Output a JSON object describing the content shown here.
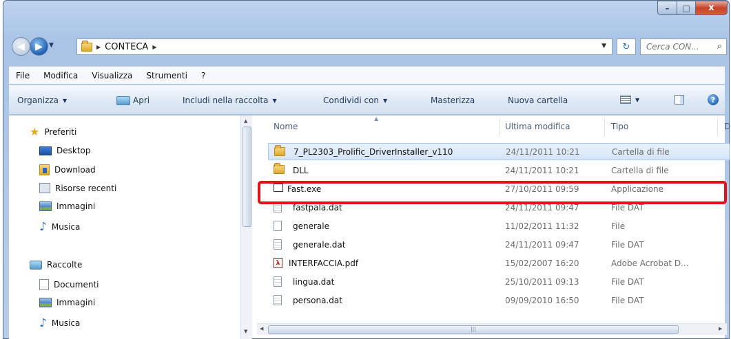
{
  "window": {
    "caption_buttons": {
      "minimize": "–",
      "maximize": "□",
      "close": "x"
    }
  },
  "address_bar": {
    "crumbs": [
      "CONTECA"
    ],
    "search_placeholder": "Cerca CON..."
  },
  "menu": [
    "File",
    "Modifica",
    "Visualizza",
    "Strumenti",
    "?"
  ],
  "commands": {
    "organize": "Organizza",
    "open": "Apri",
    "include": "Includi nella raccolta",
    "share": "Condividi con",
    "burn": "Masterizza",
    "new_folder": "Nuova cartella"
  },
  "navigation": {
    "favorites_header": "Preferiti",
    "favorites": [
      "Desktop",
      "Download",
      "Risorse recenti",
      "Immagini",
      "Musica"
    ],
    "libraries_header": "Raccolte",
    "libraries": [
      "Documenti",
      "Immagini",
      "Musica"
    ]
  },
  "file_list": {
    "columns": [
      "Nome",
      "Ultima modifica",
      "Tipo",
      "D"
    ],
    "rows": [
      {
        "name": "7_PL2303_Prolific_DriverInstaller_v110",
        "modified": "24/11/2011 10:21",
        "type": "Cartella di file",
        "icon": "folder-icon"
      },
      {
        "name": "DLL",
        "modified": "24/11/2011 10:21",
        "type": "Cartella di file",
        "icon": "folder-icon"
      },
      {
        "name": "Fast.exe",
        "modified": "27/10/2011 09:59",
        "type": "Applicazione",
        "icon": "exe-icon"
      },
      {
        "name": "fastpala.dat",
        "modified": "24/11/2011 09:47",
        "type": "File DAT",
        "icon": "dat-file-icon"
      },
      {
        "name": "generale",
        "modified": "11/02/2011 11:32",
        "type": "File",
        "icon": "file-icon"
      },
      {
        "name": "generale.dat",
        "modified": "24/11/2011 09:47",
        "type": "File DAT",
        "icon": "dat-file-icon"
      },
      {
        "name": "INTERFACCIA.pdf",
        "modified": "15/02/2007 16:20",
        "type": "Adobe Acrobat D...",
        "icon": "pdf-icon"
      },
      {
        "name": "lingua.dat",
        "modified": "25/10/2011 09:13",
        "type": "File DAT",
        "icon": "dat-file-icon"
      },
      {
        "name": "persona.dat",
        "modified": "09/09/2010 16:50",
        "type": "File DAT",
        "icon": "dat-file-icon"
      }
    ]
  },
  "colors": {
    "highlight": "#e3101a",
    "selection": "#d4e5f8"
  }
}
